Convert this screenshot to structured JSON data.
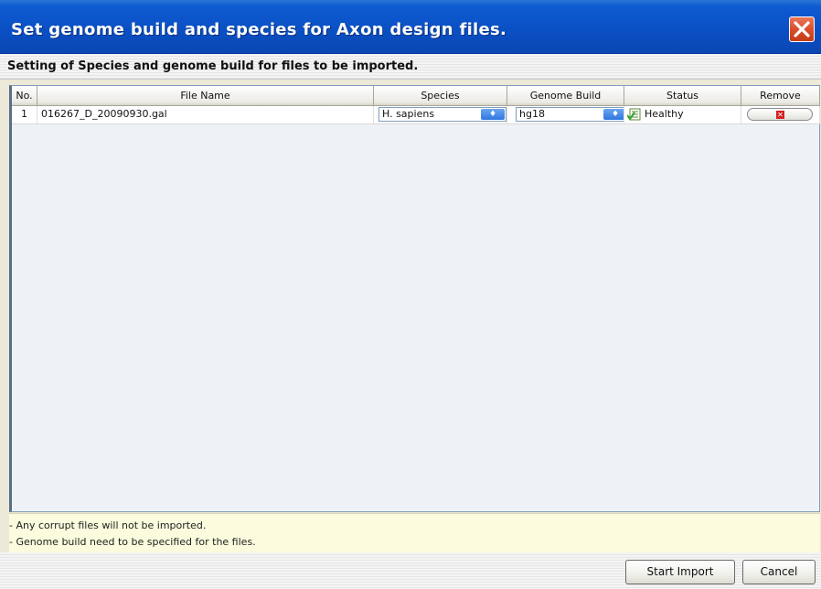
{
  "window": {
    "title": "Set genome build and species for Axon design files.",
    "subtitle": "Setting of Species and genome build for files to be imported."
  },
  "table": {
    "columns": [
      "No.",
      "File Name",
      "Species",
      "Genome Build",
      "Status",
      "Remove"
    ],
    "rows": [
      {
        "no": "1",
        "file_name": "016267_D_20090930.gal",
        "species": "H. sapiens",
        "genome_build": "hg18",
        "status": "Healthy"
      }
    ]
  },
  "notes": [
    "- Any corrupt files will not be imported.",
    "- Genome build need to be specified for the files."
  ],
  "buttons": {
    "start_import": "Start Import",
    "cancel": "Cancel"
  },
  "colors": {
    "titlebar": "#0a4fc2",
    "close_button": "#d94b26",
    "notes_background": "#fbfbdd",
    "table_background": "#eef2f6"
  }
}
